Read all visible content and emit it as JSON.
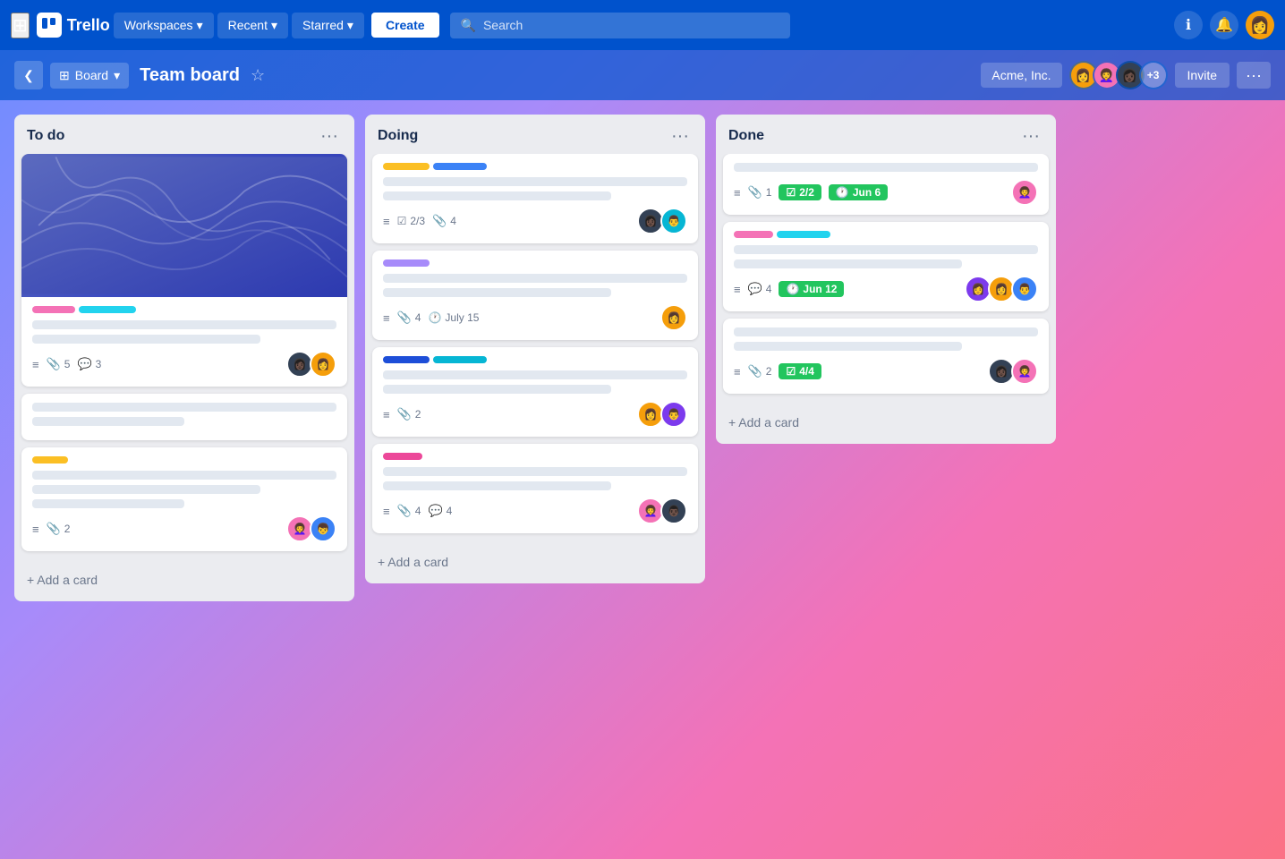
{
  "navbar": {
    "logo_text": "Trello",
    "workspaces": "Workspaces",
    "recent": "Recent",
    "starred": "Starred",
    "create": "Create",
    "search_placeholder": "Search"
  },
  "board_header": {
    "view": "Board",
    "title": "Team board",
    "workspace": "Acme, Inc.",
    "member_count": "+3",
    "invite": "Invite"
  },
  "lists": [
    {
      "id": "todo",
      "title": "To do",
      "add_card": "+ Add a card",
      "cards": [
        {
          "id": "card-1",
          "has_cover": true,
          "labels": [
            "pink",
            "cyan"
          ],
          "lines": [
            "full",
            "3q"
          ],
          "meta": [
            {
              "icon": "≡",
              "value": null
            },
            {
              "icon": "📎",
              "value": "5"
            },
            {
              "icon": "💬",
              "value": "3"
            }
          ],
          "avatars": [
            "dark-woman",
            "yellow-woman"
          ]
        },
        {
          "id": "card-2",
          "has_cover": false,
          "labels": [],
          "lines": [
            "full",
            "half"
          ],
          "meta": [],
          "avatars": []
        },
        {
          "id": "card-3",
          "has_cover": false,
          "labels": [
            "yellow"
          ],
          "lines": [
            "full",
            "3q",
            "half"
          ],
          "meta": [
            {
              "icon": "≡",
              "value": null
            },
            {
              "icon": "📎",
              "value": "2"
            }
          ],
          "avatars": [
            "pink-woman",
            "blue-man"
          ]
        }
      ]
    },
    {
      "id": "doing",
      "title": "Doing",
      "add_card": "+ Add a card",
      "cards": [
        {
          "id": "card-4",
          "has_cover": false,
          "labels": [
            "yellow-tag",
            "blue-tag"
          ],
          "lines": [
            "full",
            "3q"
          ],
          "meta": [
            {
              "icon": "≡",
              "value": null
            },
            {
              "icon": "☑",
              "value": "2/3"
            },
            {
              "icon": "📎",
              "value": "4"
            }
          ],
          "avatars": [
            "dark-woman2",
            "cyan-man"
          ]
        },
        {
          "id": "card-5",
          "has_cover": false,
          "labels": [
            "purple-tag"
          ],
          "lines": [
            "full",
            "3q"
          ],
          "meta": [
            {
              "icon": "≡",
              "value": null
            },
            {
              "icon": "📎",
              "value": "4"
            },
            {
              "icon": "🕐",
              "value": "July 15"
            }
          ],
          "avatars": [
            "yellow-woman2"
          ]
        },
        {
          "id": "card-6",
          "has_cover": false,
          "labels": [
            "navy-tag",
            "teal-tag"
          ],
          "lines": [
            "full",
            "3q"
          ],
          "meta": [
            {
              "icon": "≡",
              "value": null
            },
            {
              "icon": "📎",
              "value": "2"
            }
          ],
          "avatars": [
            "yellow-woman3",
            "purple-man"
          ]
        },
        {
          "id": "card-7",
          "has_cover": false,
          "labels": [
            "magenta-tag"
          ],
          "lines": [
            "full",
            "3q"
          ],
          "meta": [
            {
              "icon": "≡",
              "value": null
            },
            {
              "icon": "📎",
              "value": "4"
            },
            {
              "icon": "💬",
              "value": "4"
            }
          ],
          "avatars": [
            "pink-woman2",
            "dark-man"
          ]
        }
      ]
    },
    {
      "id": "done",
      "title": "Done",
      "add_card": "+ Add a card",
      "cards": [
        {
          "id": "card-8",
          "has_cover": false,
          "labels": [],
          "lines": [
            "full"
          ],
          "meta": [
            {
              "icon": "≡",
              "value": null
            },
            {
              "icon": "📎",
              "value": "1"
            }
          ],
          "badge": {
            "type": "check",
            "text": "2/2"
          },
          "date_badge": "Jun 6",
          "avatars": [
            "pink-woman3"
          ]
        },
        {
          "id": "card-9",
          "has_cover": false,
          "labels": [
            "pink-tag",
            "cyan-tag"
          ],
          "lines": [
            "full",
            "3q"
          ],
          "meta": [
            {
              "icon": "≡",
              "value": null
            },
            {
              "icon": "💬",
              "value": "4"
            }
          ],
          "date_badge": "Jun 12",
          "avatars": [
            "purple-woman",
            "yellow-woman4",
            "blue-man2"
          ]
        },
        {
          "id": "card-10",
          "has_cover": false,
          "labels": [],
          "lines": [
            "full",
            "3q"
          ],
          "meta": [
            {
              "icon": "≡",
              "value": null
            },
            {
              "icon": "📎",
              "value": "2"
            }
          ],
          "badge": {
            "type": "check",
            "text": "4/4"
          },
          "avatars": [
            "dark-woman3",
            "pink-woman4"
          ]
        }
      ]
    }
  ]
}
